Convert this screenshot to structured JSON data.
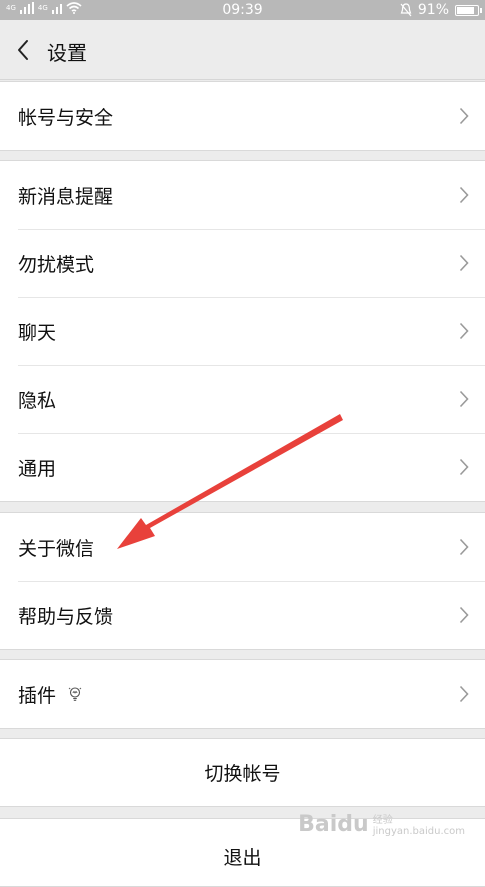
{
  "status_bar": {
    "network_type": "4G",
    "network_type2": "4G",
    "time": "09:39",
    "battery": "91%",
    "battery_level": 0.91
  },
  "nav": {
    "title": "设置"
  },
  "groups": {
    "account": [
      {
        "label": "帐号与安全"
      }
    ],
    "main": [
      {
        "label": "新消息提醒"
      },
      {
        "label": "勿扰模式"
      },
      {
        "label": "聊天"
      },
      {
        "label": "隐私"
      },
      {
        "label": "通用"
      }
    ],
    "about": [
      {
        "label": "关于微信"
      },
      {
        "label": "帮助与反馈"
      }
    ],
    "plugins": [
      {
        "label": "插件"
      }
    ]
  },
  "actions": {
    "switch_account": "切换帐号",
    "logout": "退出"
  },
  "watermark": {
    "brand": "Baidu",
    "sub1": "经验",
    "sub2": "jingyan.baidu.com"
  },
  "colors": {
    "annotation_arrow": "#e8413b",
    "status_bar": "#b8b8b8",
    "background": "#ececec"
  }
}
